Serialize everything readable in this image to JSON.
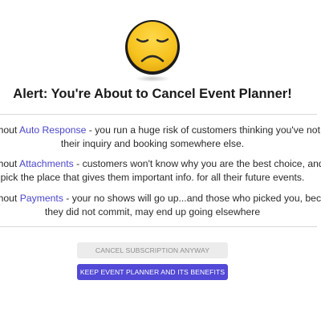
{
  "alert": {
    "title": "Alert: You're About to Cancel Event Planner!",
    "emoji_icon": "sad-face-icon",
    "emoji_color": "#f6c31f"
  },
  "features": [
    {
      "prefix": "Without ",
      "feature": "Auto Response",
      "rest_line1": " - you run a huge risk of customers thinking you've not seen",
      "line2": "their inquiry and booking somewhere else."
    },
    {
      "prefix": "Without ",
      "feature": "Attachments",
      "rest_line1": " - customers won't know why you are the best choice, and will",
      "line2": "pick the place that gives them important info. for all their future events."
    },
    {
      "prefix": "Without ",
      "feature": "Payments",
      "rest_line1": " - your no shows will go up...and those who picked you, because",
      "line2": "they did not commit, may end up going elsewhere"
    }
  ],
  "buttons": {
    "cancel_label": "CANCEL SUBSCRIPTION ANYWAY",
    "keep_label": "KEEP EVENT PLANNER AND ITS BENEFITS"
  },
  "colors": {
    "highlight": "#4b46c9",
    "primary_button": "#5249d6",
    "secondary_button": "#ececec"
  }
}
